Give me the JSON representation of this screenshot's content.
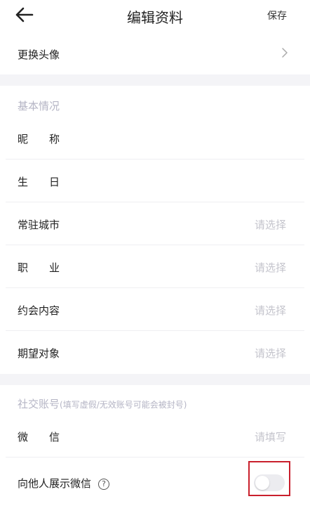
{
  "header": {
    "back_icon": "arrow-left-icon",
    "title": "编辑资料",
    "save_label": "保存"
  },
  "avatar_row": {
    "label": "更换头像",
    "chevron_icon": "chevron-right-icon"
  },
  "basic_section": {
    "title": "基本情况",
    "rows": [
      {
        "label": "昵　　称",
        "value": ""
      },
      {
        "label": "生　　日",
        "value": ""
      },
      {
        "label": "常驻城市",
        "value": "请选择"
      },
      {
        "label": "职　　业",
        "value": "请选择"
      },
      {
        "label": "约会内容",
        "value": "请选择"
      },
      {
        "label": "期望对象",
        "value": "请选择"
      }
    ]
  },
  "social_section": {
    "title": "社交账号",
    "subtitle": "(填写虚假/无效账号可能会被封号)",
    "wechat": {
      "label": "微　　信",
      "placeholder": "请填写"
    },
    "show_wechat": {
      "label": "向他人展示微信",
      "help_icon": "question-circle-icon",
      "help_glyph": "?",
      "enabled": false
    }
  },
  "colors": {
    "highlight_border": "#c91f2c",
    "placeholder": "#c4c4cc",
    "section_title": "#b5b5c5",
    "band": "#f4f4f7"
  }
}
